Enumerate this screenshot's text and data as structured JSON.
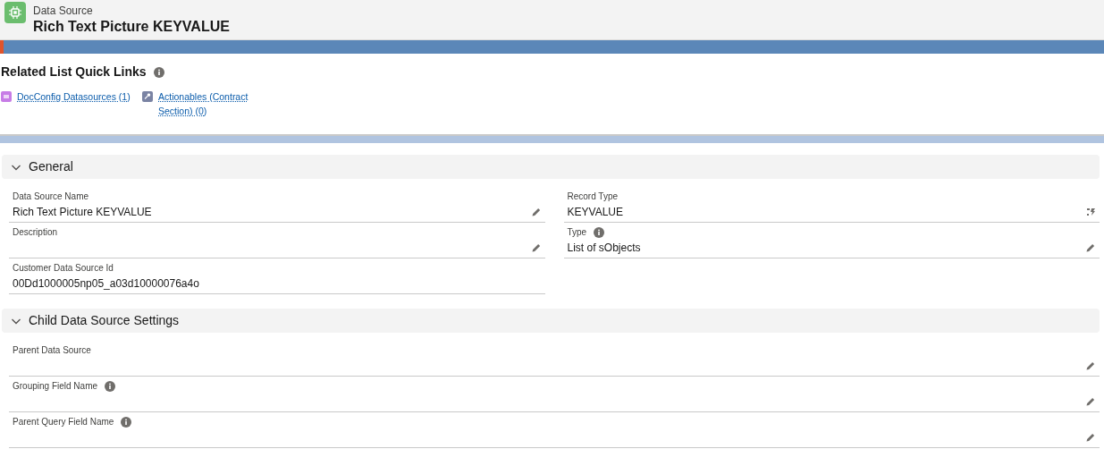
{
  "header": {
    "object_type": "Data Source",
    "title": "Rich Text Picture KEYVALUE"
  },
  "quick_links": {
    "title": "Related List Quick Links",
    "info": true,
    "links": [
      {
        "label": "DocConfig Datasources (1)",
        "kind": "list",
        "color": "#c77ce6"
      },
      {
        "label": "Actionables (Contract Section) (0)",
        "kind": "wrench",
        "color": "#7a83a3"
      }
    ]
  },
  "sections": [
    {
      "title": "General",
      "expanded": true,
      "columns": [
        [
          {
            "label": "Data Source Name",
            "value": "Rich Text Picture KEYVALUE",
            "kind": "edit",
            "info": false
          },
          {
            "label": "Description",
            "kind": "edit",
            "info": false
          },
          {
            "label": "Customer Data Source Id",
            "value": "00Dd1000005np05_a03d10000076a4o",
            "kind": "readonly",
            "info": false
          }
        ],
        [
          {
            "label": "Record Type",
            "value": "KEYVALUE",
            "kind": "change",
            "info": false
          },
          {
            "label": "Type",
            "value": "List of sObjects",
            "kind": "edit",
            "info": true
          }
        ]
      ]
    },
    {
      "title": "Child Data Source Settings",
      "expanded": true,
      "columns": [
        [
          {
            "label": "Parent Data Source",
            "kind": "edit",
            "info": false
          },
          {
            "label": "Grouping Field Name",
            "kind": "edit",
            "info": true
          },
          {
            "label": "Parent Query Field Name",
            "kind": "edit",
            "info": true
          }
        ]
      ]
    }
  ]
}
